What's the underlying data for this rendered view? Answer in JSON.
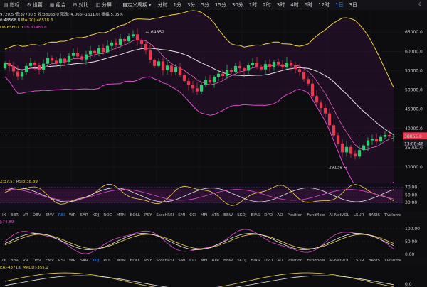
{
  "toolbar": {
    "buttons": [
      {
        "icon": "chart-icon",
        "glyph": "▤",
        "label": "指标"
      },
      {
        "icon": "gear-icon",
        "glyph": "⚙",
        "label": "设置"
      },
      {
        "icon": "grid-icon",
        "glyph": "▦",
        "label": "组合"
      },
      {
        "icon": "compare-icon",
        "glyph": "⊞",
        "label": "对比"
      },
      {
        "icon": "layout-icon",
        "glyph": "◫",
        "label": "分屏"
      }
    ],
    "custom_period_label": "自定义周期",
    "timeframes": [
      "分时",
      "1分",
      "3分",
      "5分",
      "15分",
      "30分",
      "1时",
      "2时",
      "3时",
      "4时",
      "6时",
      "12时",
      "1日",
      "3日"
    ],
    "active_timeframe": "1日",
    "right_icon": "moon-icon",
    "right_glyph": "☾"
  },
  "info": {
    "line1": "9720.5  低:37700.5  收:38055.0  涨跌:-4,065(-1611.0)  振幅:5.05%",
    "ma_line": [
      {
        "text": "0:48568.8",
        "color": "#e6e6e6"
      },
      {
        "text": "MA(20):46518.3",
        "color": "#f1d54a"
      }
    ],
    "boll_line": [
      {
        "text": "UB:65607.0",
        "color": "#f1d54a"
      },
      {
        "text": "LB:31486.6",
        "color": "#e24ad1"
      }
    ]
  },
  "price_axis": {
    "ticks": [
      "65000.0",
      "60000.0",
      "55000.0",
      "50000.0",
      "45000.0",
      "40000.0",
      "35000.0",
      "30000.0"
    ],
    "current_price": "38055.0",
    "countdown": "13:08:46",
    "high_label": "← 64852",
    "low_label": "29138 →"
  },
  "rsi_pane": {
    "label": "2:37.57  RSI3:38.89",
    "ticks": [
      "70.00",
      "50.00",
      "30.00"
    ]
  },
  "indicators": {
    "items": [
      "IX",
      "BBR",
      "VR",
      "OBV",
      "EMV",
      "RSI",
      "WR",
      "SAR",
      "KDJ",
      "ROC",
      "MTM",
      "BOLL",
      "PSY",
      "StochRSI",
      "SMI",
      "CCI",
      "MFI",
      "ATR",
      "BBW",
      "SKDJ",
      "BIAS",
      "DPO",
      "AO",
      "Position",
      "Fundflow",
      "AI-NetVOL",
      "LSUR",
      "BASIS",
      "TVolume"
    ],
    "active_row1": "RSI",
    "active_row2": "KDJ"
  },
  "kdj_pane": {
    "label": "J:74.89",
    "ticks": [
      "100.00",
      "50.00",
      "0.00"
    ]
  },
  "macd_pane": {
    "label": "EA:-4371.0  MACD:-355.2",
    "tick": "0.0"
  },
  "colors": {
    "up": "#2ecc71",
    "down": "#e8384f",
    "ub": "#f1d54a",
    "lb": "#e24ad1",
    "ma": "#e6e6e6",
    "accent": "#3b8cff"
  }
}
